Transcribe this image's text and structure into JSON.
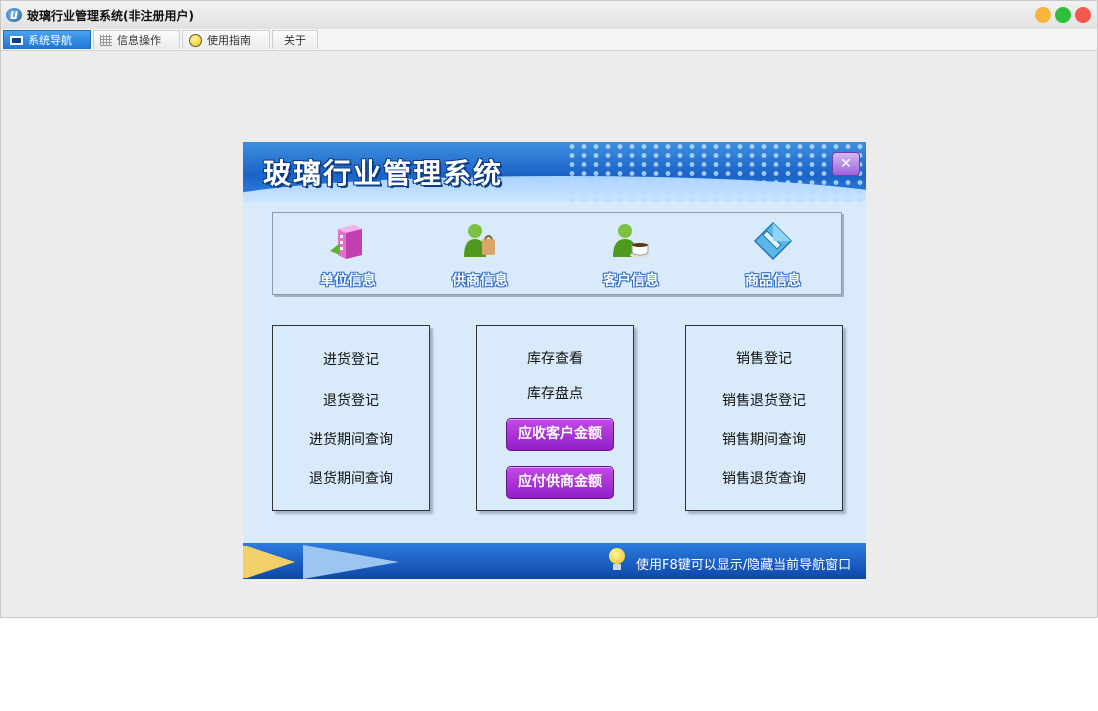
{
  "window": {
    "title": "玻璃行业管理系统(非注册用户)"
  },
  "tabs": [
    {
      "label": "系统导航",
      "icon": "monitor-icon",
      "active": true
    },
    {
      "label": "信息操作",
      "icon": "grid-icon",
      "active": false
    },
    {
      "label": "使用指南",
      "icon": "bulb-icon",
      "active": false
    },
    {
      "label": "关于",
      "icon": "",
      "active": false
    }
  ],
  "nav": {
    "title": "玻璃行业管理系统",
    "close_label": "✕",
    "info_items": [
      {
        "label": "单位信息",
        "icon": "building-icon"
      },
      {
        "label": "供商信息",
        "icon": "supplier-icon"
      },
      {
        "label": "客户信息",
        "icon": "customer-icon"
      },
      {
        "label": "商品信息",
        "icon": "goods-icon"
      }
    ],
    "purchase": [
      "进货登记",
      "退货登记",
      "进货期间查询",
      "退货期间查询"
    ],
    "inventory": [
      "库存查看",
      "库存盘点"
    ],
    "inventory_buttons": [
      "应收客户金额",
      "应付供商金额"
    ],
    "sales": [
      "销售登记",
      "销售退货登记",
      "销售期间查询",
      "销售退货查询"
    ],
    "footer_tip": "使用F8键可以显示/隐藏当前导航窗口"
  },
  "colors": {
    "accent": "#1e74d2",
    "purple_button": "#a233d6",
    "panel_bg": "#d9eafa"
  }
}
